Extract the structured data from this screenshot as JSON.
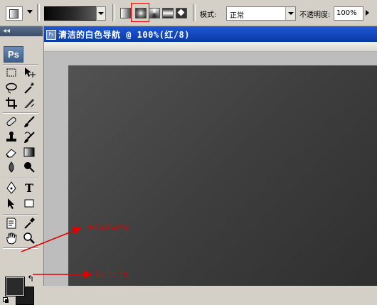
{
  "options_bar": {
    "mode_label": "模式:",
    "mode_value": "正常",
    "opacity_label": "不透明度:",
    "opacity_value": "100%"
  },
  "document": {
    "title": "清洁的白色导航 @ 100%(红/8)"
  },
  "toolbox": {
    "collapse_glyph": "◂◂",
    "logo": "Ps",
    "foreground_color": "#2a2a2a",
    "background_color": "#1c1c1c"
  },
  "annotations": {
    "foreground_hex": "#2a2a2a",
    "background_hex": "1c1c1c",
    "color": "#e10000"
  },
  "icons": [
    "gradient-preset-icon",
    "linear-gradient-icon",
    "radial-gradient-icon",
    "angle-gradient-icon",
    "reflected-gradient-icon",
    "diamond-gradient-icon",
    "marquee-icon",
    "move-icon",
    "lasso-icon",
    "magic-wand-icon",
    "crop-icon",
    "slice-icon",
    "healing-brush-icon",
    "brush-icon",
    "clone-stamp-icon",
    "history-brush-icon",
    "eraser-icon",
    "gradient-tool-icon",
    "blur-icon",
    "dodge-icon",
    "pen-icon",
    "type-icon",
    "path-select-icon",
    "shape-icon",
    "notes-icon",
    "eyedropper-icon",
    "hand-icon",
    "zoom-icon",
    "swap-colors-icon",
    "default-colors-icon"
  ]
}
